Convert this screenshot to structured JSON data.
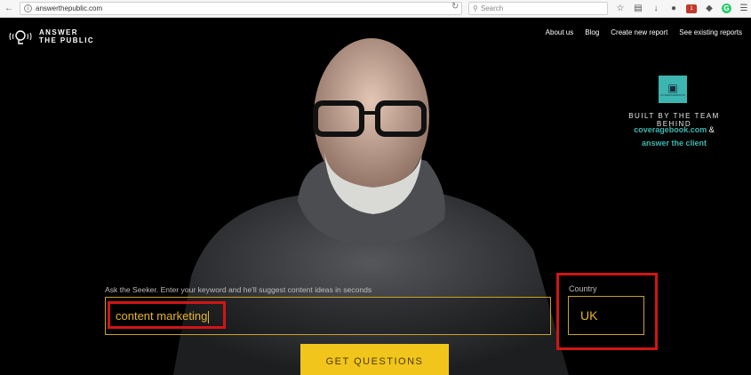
{
  "browser": {
    "url": "answerthepublic.com",
    "search_placeholder": "Search",
    "badge_count": "1"
  },
  "site": {
    "logo_line1": "ANSWER",
    "logo_line2": "THE PUBLIC",
    "nav": [
      "About us",
      "Blog",
      "Create new report",
      "See existing reports"
    ]
  },
  "promo": {
    "built_by": "BUILT BY THE TEAM BEHIND",
    "link1": "coveragebook.com",
    "amp": "&",
    "link2": "answer the client",
    "logo_text": "COVERAGEBOOK"
  },
  "form": {
    "seeker_label": "Ask the Seeker. Enter your keyword and he'll suggest content ideas in seconds",
    "keyword_value": "content marketing",
    "country_label": "Country",
    "country_value": "UK",
    "submit_label": "GET QUESTIONS"
  },
  "colors": {
    "accent_yellow": "#f2c51c",
    "input_text": "#e5b625",
    "highlight_red": "#d11515",
    "teal": "#3db5b0"
  }
}
